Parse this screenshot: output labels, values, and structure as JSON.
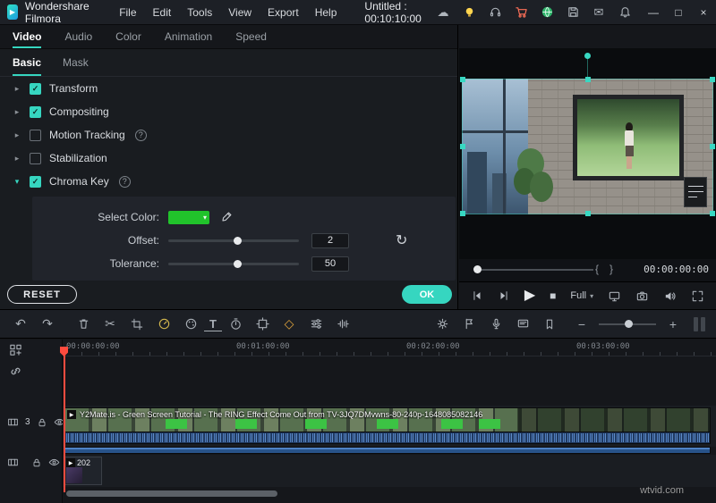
{
  "titlebar": {
    "app_name": "Wondershare Filmora",
    "menus": [
      "File",
      "Edit",
      "Tools",
      "View",
      "Export",
      "Help"
    ],
    "document_title": "Untitled : 00:10:10:00"
  },
  "icons": {
    "logo_play": "▶",
    "cloud": "☁",
    "mail": "✉",
    "minimize": "—",
    "maximize": "□",
    "close": "×",
    "undo": "↶",
    "redo": "↷",
    "scissors": "✂",
    "keyframe": "◇",
    "text_tool": "T",
    "caret_right": "▸",
    "caret_down": "▾",
    "check": "✓",
    "help": "?",
    "dropdown": "▾",
    "reset": "↻",
    "zoom_out": "−",
    "zoom_in": "+",
    "play": "▶",
    "stop": "■",
    "brace_open": "{",
    "brace_close": "}",
    "play_badge": "▶"
  },
  "tabs": {
    "items": [
      "Video",
      "Audio",
      "Color",
      "Animation",
      "Speed"
    ],
    "active": "Video"
  },
  "subtabs": {
    "items": [
      "Basic",
      "Mask"
    ],
    "active": "Basic"
  },
  "properties": {
    "items": [
      {
        "label": "Transform",
        "checked": true
      },
      {
        "label": "Compositing",
        "checked": true
      },
      {
        "label": "Motion Tracking",
        "checked": false
      },
      {
        "label": "Stabilization",
        "checked": false
      },
      {
        "label": "Chroma Key",
        "checked": true
      }
    ],
    "chroma": {
      "select_color_label": "Select Color:",
      "offset_label": "Offset:",
      "offset_value": "2",
      "tolerance_label": "Tolerance:",
      "tolerance_value": "50"
    },
    "reset_label": "RESET",
    "ok_label": "OK"
  },
  "preview": {
    "timecode": "00:00:00:00",
    "quality": "Full"
  },
  "timeline": {
    "ruler": [
      "00:00:00:00",
      "00:01:00:00",
      "00:02:00:00",
      "00:03:00:00"
    ],
    "tracks": [
      {
        "number": "3"
      },
      {
        "number": ""
      }
    ],
    "clip1_title": "Y2Mate.is - Green Screen Tutorial - The RING Effect   Come Out from TV-3JQ7DMvwns-80-240p-1648085082146",
    "clip2_label": "202"
  },
  "watermark": "wtvid.com",
  "colors": {
    "accent_teal": "#36d6c0",
    "chroma_green": "#21c32b",
    "playhead_red": "#ff4b3e",
    "cart_red": "#ff7058",
    "bulb_yellow": "#ffd54f"
  }
}
